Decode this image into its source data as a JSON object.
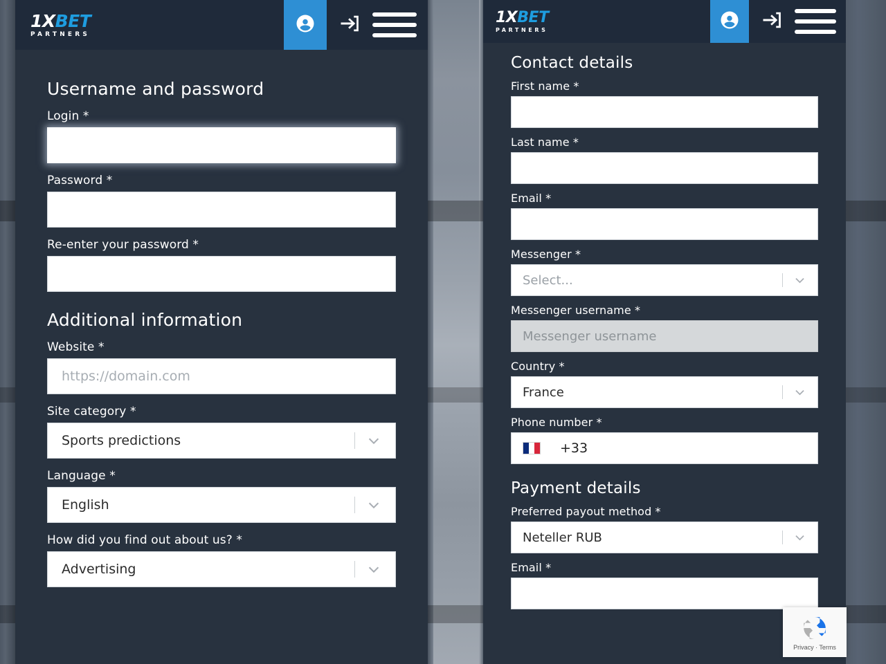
{
  "brand": {
    "logo_main_1": "1X",
    "logo_main_2": "BET",
    "logo_sub": "PARTNERS",
    "accent_color": "#2e8fd4",
    "panel_bg": "#28323f",
    "header_bg": "#1f2a3a"
  },
  "header": {
    "account_icon": "user-circle-icon",
    "login_icon": "sign-in-icon",
    "menu_icon": "hamburger-menu-icon"
  },
  "left_panel": {
    "section_1_title": "Username and password",
    "fields": [
      {
        "label": "Login *",
        "value": "",
        "placeholder": "",
        "state": "focused",
        "type": "text"
      },
      {
        "label": "Password *",
        "value": "",
        "placeholder": "",
        "state": "normal",
        "type": "text"
      },
      {
        "label": "Re-enter your password *",
        "value": "",
        "placeholder": "",
        "state": "normal",
        "type": "text"
      }
    ],
    "section_2_title": "Additional information",
    "fields_2": [
      {
        "label": "Website *",
        "value": "",
        "placeholder": "https://domain.com",
        "state": "normal",
        "type": "text"
      },
      {
        "label": "Site category *",
        "value": "Sports predictions",
        "state": "normal",
        "type": "select"
      },
      {
        "label": "Language *",
        "value": "English",
        "state": "normal",
        "type": "select"
      },
      {
        "label": "How did you find out about us? *",
        "value": "Advertising",
        "state": "normal",
        "type": "select"
      }
    ]
  },
  "right_panel": {
    "section_1_title": "Contact details",
    "fields": [
      {
        "label": "First name *",
        "value": "",
        "placeholder": "",
        "state": "normal",
        "type": "text"
      },
      {
        "label": "Last name *",
        "value": "",
        "placeholder": "",
        "state": "normal",
        "type": "text"
      },
      {
        "label": "Email *",
        "value": "",
        "placeholder": "",
        "state": "normal",
        "type": "text"
      },
      {
        "label": "Messenger *",
        "value": "Select...",
        "state": "placeholder",
        "type": "select"
      },
      {
        "label": "Messenger username *",
        "value": "",
        "placeholder": "Messenger username",
        "state": "disabled",
        "type": "text"
      },
      {
        "label": "Country *",
        "value": "France",
        "state": "normal",
        "type": "select"
      }
    ],
    "phone": {
      "label": "Phone number *",
      "flag": "france-flag-icon",
      "code": "+33"
    },
    "section_2_title": "Payment details",
    "payout": {
      "label": "Preferred payout method *",
      "value": "Neteller RUB"
    },
    "payout_email_label": "Email *"
  },
  "recaptcha": {
    "icon": "recaptcha-logo-icon",
    "privacy": "Privacy",
    "separator": "·",
    "terms": "Terms",
    "text": "Privacy · Terms"
  }
}
